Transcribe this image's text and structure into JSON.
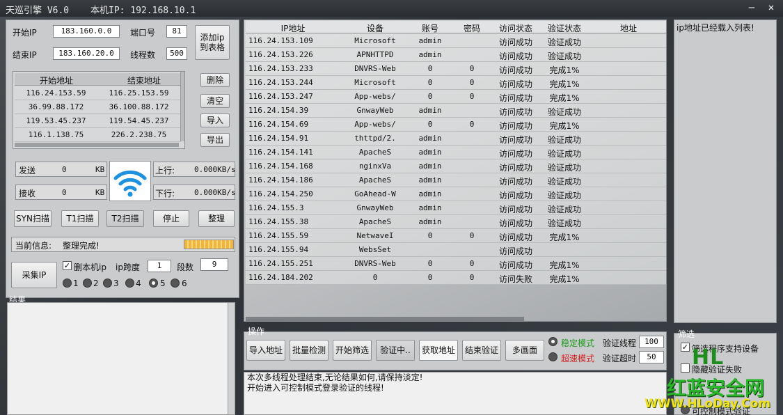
{
  "window": {
    "title": "天巡引擎 V6.0",
    "local_ip_label": "本机IP: 192.168.10.1",
    "minimize": "–",
    "close": "✕"
  },
  "ip_range": {
    "start_label": "开始IP",
    "start_value": "183.160.0.0",
    "end_label": "结束IP",
    "end_value": "183.160.20.0",
    "port_label": "端口号",
    "port_value": "81",
    "threads_label": "线程数",
    "threads_value": "500",
    "add_button": "添加ip\n到表格"
  },
  "range_table": {
    "headers": [
      "开始地址",
      "结束地址"
    ],
    "rows": [
      [
        "116.24.153.59",
        "116.25.153.59"
      ],
      [
        "36.99.88.172",
        "36.100.88.172"
      ],
      [
        "119.53.45.237",
        "119.54.45.237"
      ],
      [
        "116.1.138.75",
        "226.2.238.75"
      ]
    ]
  },
  "range_buttons": {
    "delete": "删除",
    "clear": "清空",
    "import": "导入",
    "export": "导出"
  },
  "traffic": {
    "send_label": "发送",
    "send_value": "0",
    "send_unit": "KB",
    "recv_label": "接收",
    "recv_value": "0",
    "recv_unit": "KB",
    "up_label": "上行:",
    "up_value": "0.000KB/s",
    "down_label": "下行:",
    "down_value": "0.000KB/s"
  },
  "scan_buttons": {
    "syn": "SYN扫描",
    "t1": "T1扫描",
    "t2": "T2扫描",
    "stop": "停止",
    "tidy": "整理"
  },
  "status": {
    "label": "当前信息:",
    "value": "整理完成!",
    "progress": 1.0
  },
  "collect": {
    "button": "采集IP",
    "delete_local_label": "删本机ip",
    "delete_local_checked": true,
    "span_label": "ip跨度",
    "span_value": "1",
    "segments_label": "段数",
    "segments_value": "9",
    "radio_options": [
      "1",
      "2",
      "3",
      "4",
      "5",
      "6"
    ],
    "radio_selected": "5"
  },
  "result": {
    "title": "结果"
  },
  "grid": {
    "headers": [
      "IP地址",
      "设备",
      "账号",
      "密码",
      "访问状态",
      "验证状态",
      "地址"
    ],
    "rows": [
      [
        "116.24.153.109",
        "Microsoft",
        "admin",
        "",
        "访问成功",
        "验证成功",
        ""
      ],
      [
        "116.24.153.226",
        "APNHTTPD",
        "admin",
        "",
        "访问成功",
        "验证成功",
        ""
      ],
      [
        "116.24.153.233",
        "DNVRS-Web",
        "0",
        "0",
        "访问成功",
        "完成1%",
        ""
      ],
      [
        "116.24.153.244",
        "Microsoft",
        "0",
        "0",
        "访问成功",
        "完成1%",
        ""
      ],
      [
        "116.24.153.247",
        "App-webs/",
        "0",
        "0",
        "访问成功",
        "完成1%",
        ""
      ],
      [
        "116.24.154.39",
        "GnwayWeb",
        "admin",
        "",
        "访问成功",
        "验证成功",
        ""
      ],
      [
        "116.24.154.69",
        "App-webs/",
        "0",
        "0",
        "访问成功",
        "完成1%",
        ""
      ],
      [
        "116.24.154.91",
        "thttpd/2.",
        "admin",
        "",
        "访问成功",
        "验证成功",
        ""
      ],
      [
        "116.24.154.141",
        "ApacheS",
        "admin",
        "",
        "访问成功",
        "验证成功",
        ""
      ],
      [
        "116.24.154.168",
        "nginxVa",
        "admin",
        "",
        "访问成功",
        "验证成功",
        ""
      ],
      [
        "116.24.154.186",
        "ApacheS",
        "admin",
        "",
        "访问成功",
        "验证成功",
        ""
      ],
      [
        "116.24.154.250",
        "GoAhead-W",
        "admin",
        "",
        "访问成功",
        "验证成功",
        ""
      ],
      [
        "116.24.155.3",
        "GnwayWeb",
        "admin",
        "",
        "访问成功",
        "验证成功",
        ""
      ],
      [
        "116.24.155.38",
        "ApacheS",
        "admin",
        "",
        "访问成功",
        "验证成功",
        ""
      ],
      [
        "116.24.155.59",
        "NetwaveI",
        "0",
        "0",
        "访问成功",
        "完成1%",
        ""
      ],
      [
        "116.24.155.94",
        "WebsSet",
        "",
        "",
        "访问成功",
        "",
        ""
      ],
      [
        "116.24.155.251",
        "DNVRS-Web",
        "0",
        "0",
        "访问成功",
        "完成1%",
        ""
      ],
      [
        "116.24.184.202",
        "0",
        "0",
        "0",
        "访问失败",
        "完成1%",
        ""
      ]
    ]
  },
  "operations": {
    "title": "操作",
    "import_addr": "导入地址",
    "batch_check": "批量检测",
    "start_filter": "开始筛选",
    "verifying": "验证中..",
    "get_addr": "获取地址",
    "end_verify": "结束验证",
    "multi_screen": "多画面",
    "stable_mode": "稳定模式",
    "stable_color": "#1a9a1a",
    "fast_mode": "超速模式",
    "fast_color": "#d42020",
    "verify_threads_label": "验证线程",
    "verify_threads_value": "100",
    "verify_timeout_label": "验证超时",
    "verify_timeout_value": "50"
  },
  "log": {
    "lines": [
      "本次多线程处理结束,无论结果如何,请保持淡定!",
      "开始进入可控制模式登录验证的线程!"
    ]
  },
  "right_panel": {
    "message": "ip地址已经载入列表!"
  },
  "filter": {
    "title": "筛选",
    "support_device": "筛选程序支持设备",
    "support_device_checked": true,
    "hide_failed": "隐藏验证失败",
    "controllable_verify": "可控制模式验证"
  },
  "watermark": {
    "logo": "HL",
    "name": "红蓝安全网",
    "url": "WWW.HLoDay.Com"
  }
}
